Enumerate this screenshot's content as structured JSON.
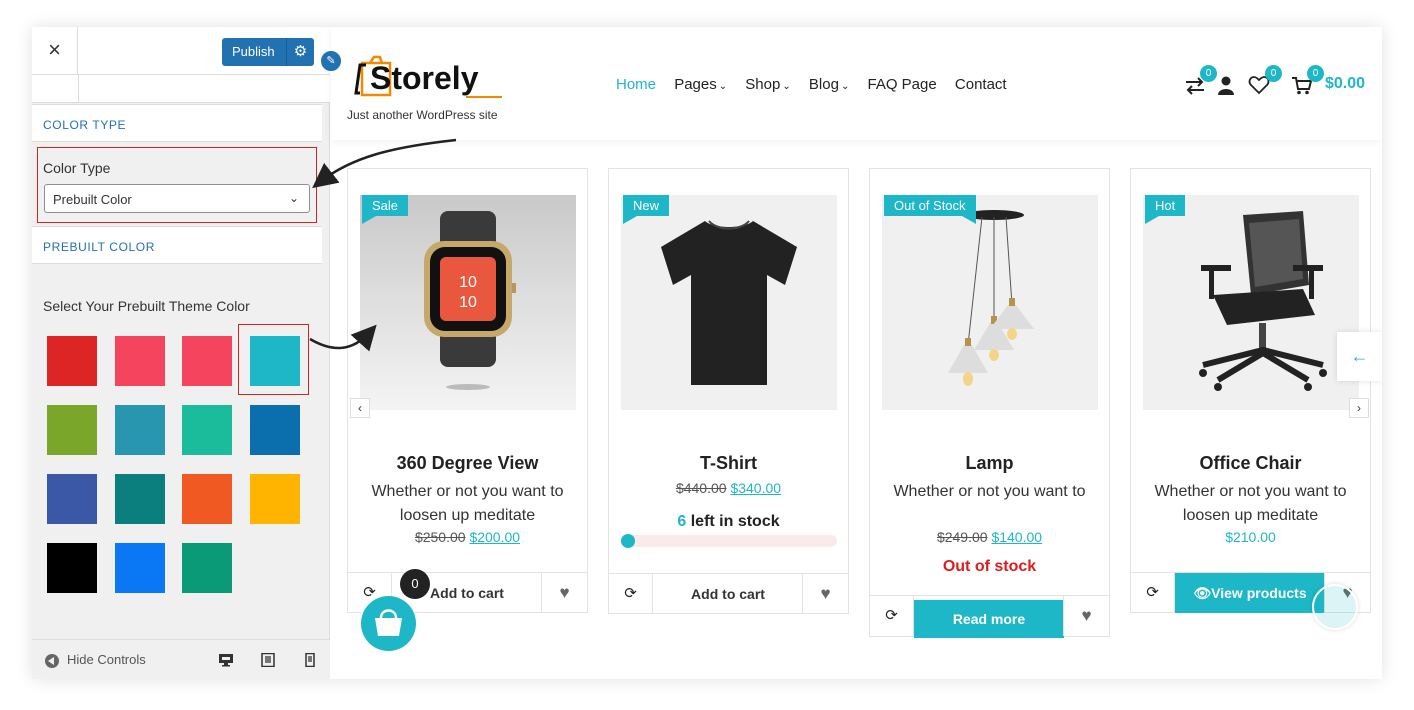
{
  "customizer": {
    "close": "×",
    "publish": "Publish",
    "section_color_type": "COLOR TYPE",
    "color_type_label": "Color Type",
    "color_type_value": "Prebuilt Color",
    "section_prebuilt": "PREBUILT COLOR",
    "swatch_title": "Select Your Prebuilt Theme Color",
    "swatches": [
      "#dd2525",
      "#f4445e",
      "#f4445e",
      "#1eb7c7",
      "#7aa72a",
      "#2896ae",
      "#1abc9c",
      "#0b6fae",
      "#3b58a6",
      "#0b7f7d",
      "#f05a22",
      "#ffb400",
      "#000000",
      "#0a77f5",
      "#0b9a77"
    ],
    "selected_swatch": "#1eb7c7",
    "hide_controls": "Hide Controls"
  },
  "site": {
    "logo_text": "Storely",
    "tagline": "Just another WordPress site",
    "nav": [
      "Home",
      "Pages",
      "Shop",
      "Blog",
      "FAQ Page",
      "Contact"
    ],
    "active_nav": "Home",
    "compare_count": "0",
    "wishlist_count": "0",
    "cart_count": "0",
    "cart_total": "$0.00",
    "accent": "#1eb7c7"
  },
  "products": [
    {
      "tag": "Sale",
      "name": "360 Degree View",
      "desc": "Whether or not you want to loosen up meditate",
      "old": "$250.00",
      "price": "$200.00",
      "action": "Add to cart"
    },
    {
      "tag": "New",
      "name": "T-Shirt",
      "old": "$440.00",
      "price": "$340.00",
      "stock_count": "6",
      "stock_text": "left in stock",
      "action": "Add to cart"
    },
    {
      "tag": "Out of Stock",
      "name": "Lamp",
      "desc": "Whether or not you want to",
      "old": "$249.00",
      "price": "$140.00",
      "status": "Out of stock",
      "action": "Read more"
    },
    {
      "tag": "Hot",
      "name": "Office Chair",
      "desc": "Whether or not you want to loosen up meditate",
      "price": "$210.00",
      "action": "View products"
    }
  ],
  "floating_cart_count": "0"
}
